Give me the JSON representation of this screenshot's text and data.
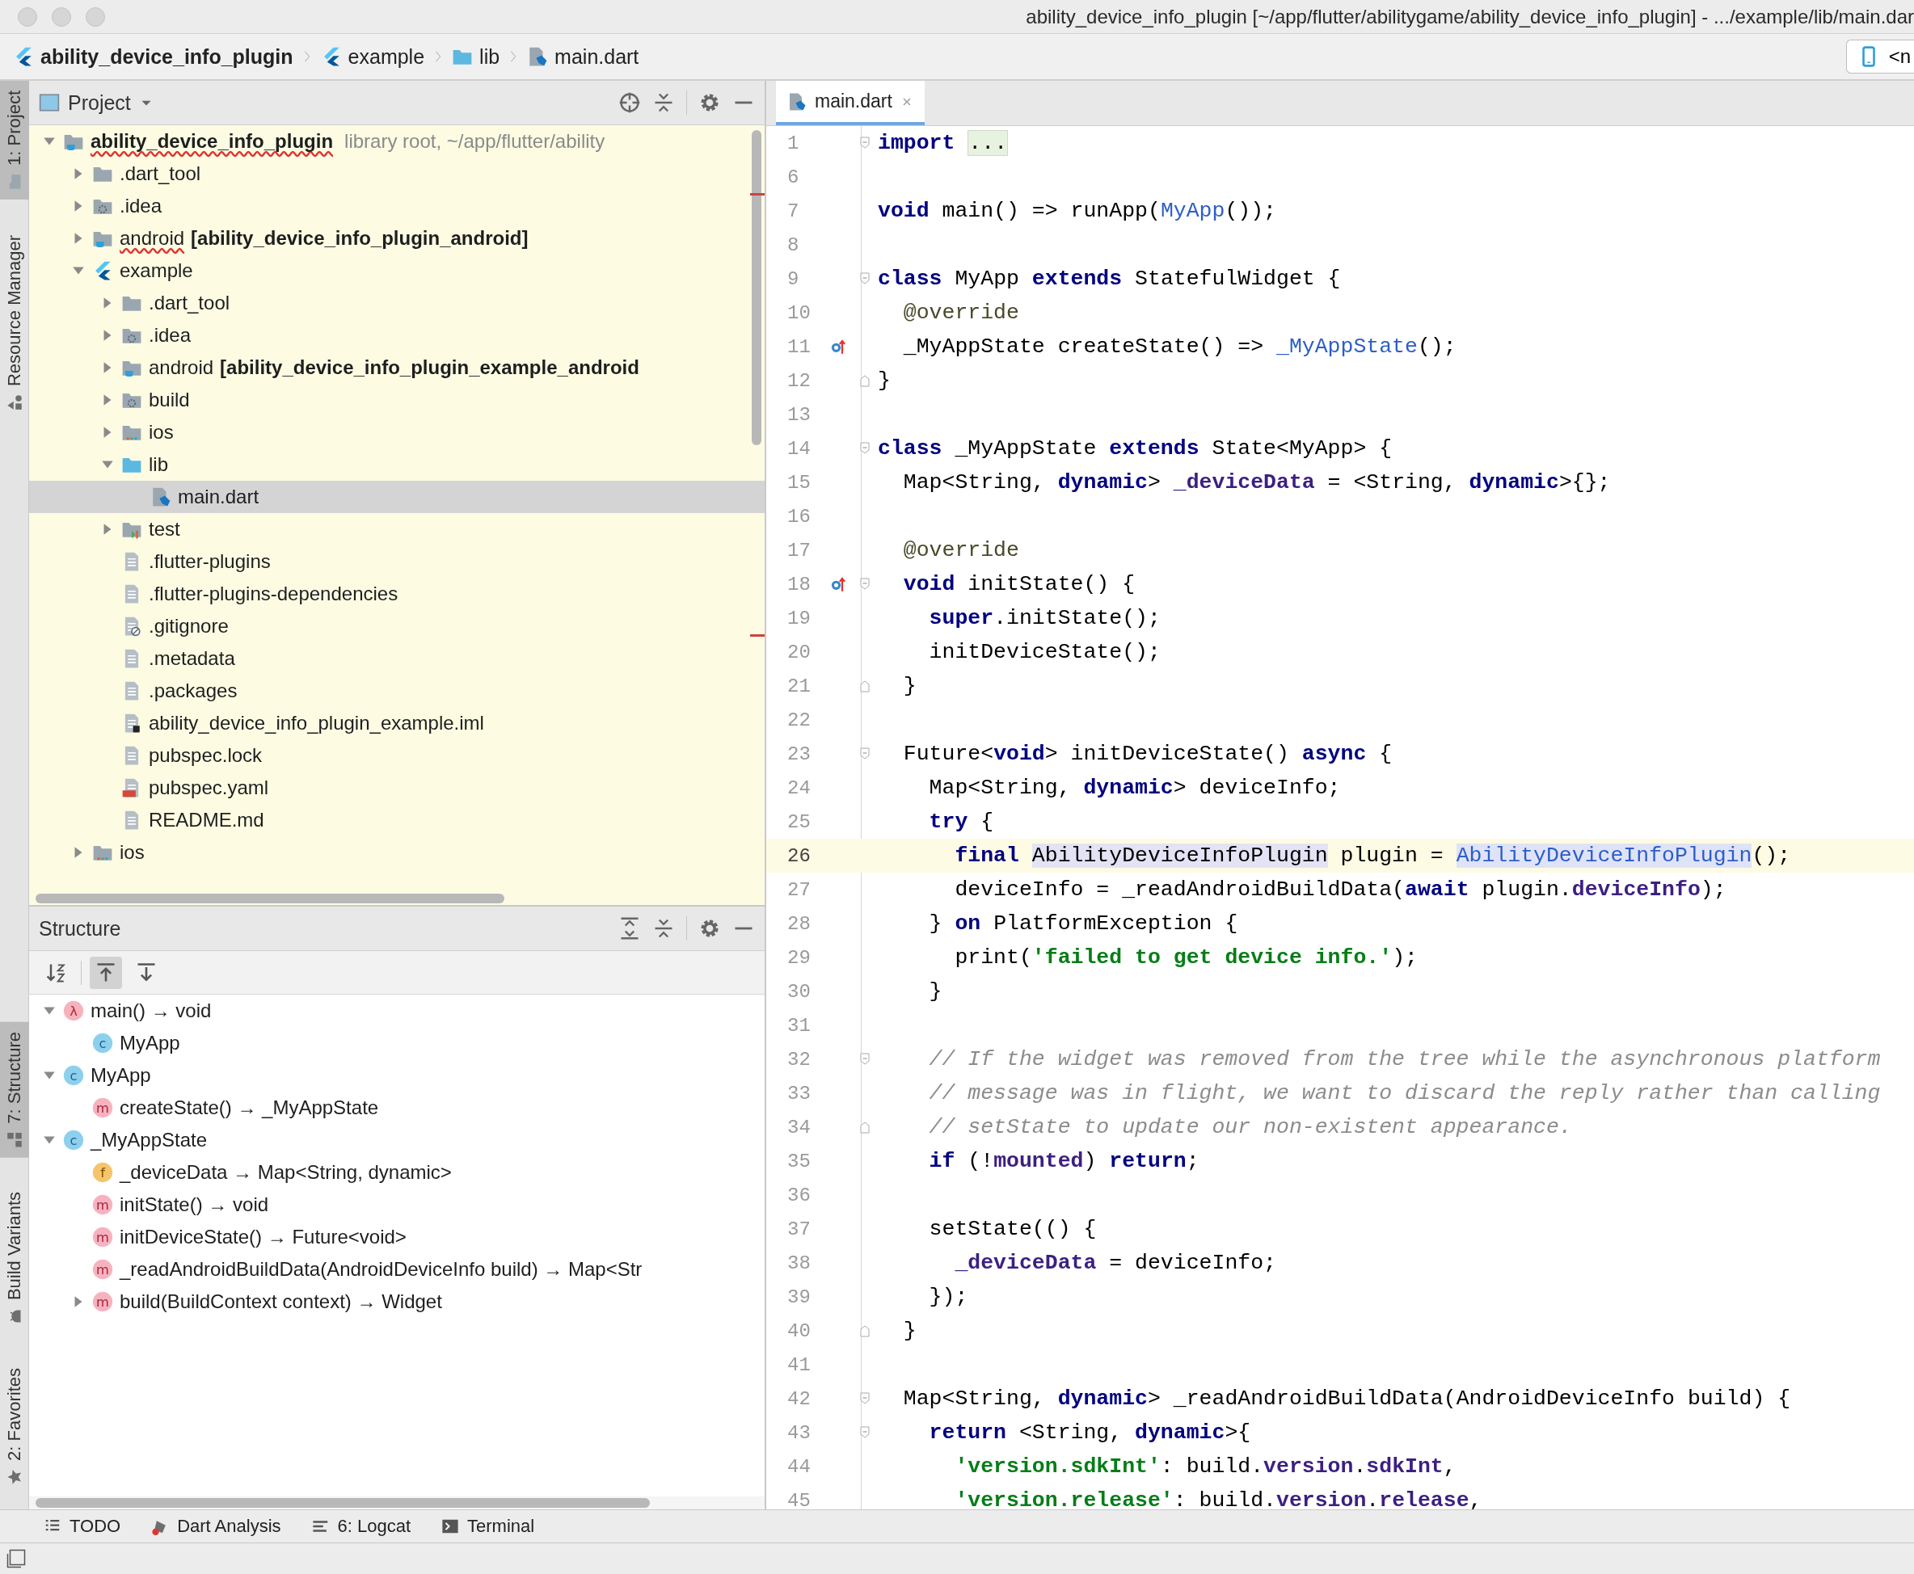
{
  "window": {
    "title": "ability_device_info_plugin [~/app/flutter/abilitygame/ability_device_info_plugin] - .../example/lib/main.dar"
  },
  "breadcrumbs": [
    {
      "label": "ability_device_info_plugin",
      "kind": "flutter"
    },
    {
      "label": "example",
      "kind": "flutter"
    },
    {
      "label": "lib",
      "kind": "folder-source"
    },
    {
      "label": "main.dart",
      "kind": "dart"
    }
  ],
  "device_selector": {
    "text": "<n"
  },
  "tool_stripe": {
    "top": [
      {
        "label": "1: Project",
        "selected": true,
        "kind": "folder"
      },
      {
        "label": "Resource Manager",
        "selected": false,
        "kind": "resources"
      }
    ],
    "bottom": [
      {
        "label": "7: Structure",
        "selected": true,
        "kind": "structure"
      },
      {
        "label": "Build Variants",
        "selected": false,
        "kind": "android"
      },
      {
        "label": "2: Favorites",
        "selected": false,
        "kind": "star"
      }
    ]
  },
  "project": {
    "title": "Project",
    "tree": [
      {
        "label": "ability_device_info_plugin",
        "hint": "library root,  ~/app/flutter/ability",
        "kind": "module",
        "misspelled": true,
        "expanded": true,
        "selected": false,
        "children": [
          {
            "label": ".dart_tool",
            "kind": "folder",
            "misspelled": false,
            "expanded": false,
            "selected": false
          },
          {
            "label": ".idea",
            "kind": "folder-config",
            "misspelled": false,
            "expanded": false,
            "selected": false
          },
          {
            "label": "android",
            "module": "[ability_device_info_plugin_android]",
            "kind": "module",
            "misspelled": true,
            "expanded": false,
            "selected": false
          },
          {
            "label": "example",
            "kind": "flutter",
            "misspelled": false,
            "expanded": true,
            "selected": false,
            "children": [
              {
                "label": ".dart_tool",
                "kind": "folder",
                "misspelled": false,
                "expanded": false,
                "selected": false
              },
              {
                "label": ".idea",
                "kind": "folder-config",
                "misspelled": false,
                "expanded": false,
                "selected": false
              },
              {
                "label": "android",
                "module": "[ability_device_info_plugin_example_android",
                "kind": "module",
                "misspelled": false,
                "expanded": false,
                "selected": false
              },
              {
                "label": "build",
                "kind": "folder-config",
                "misspelled": false,
                "expanded": false,
                "selected": false
              },
              {
                "label": "ios",
                "kind": "folder-ios",
                "misspelled": false,
                "expanded": false,
                "selected": false
              },
              {
                "label": "lib",
                "kind": "folder-source",
                "misspelled": false,
                "expanded": true,
                "selected": false,
                "children": [
                  {
                    "label": "main.dart",
                    "kind": "dart",
                    "misspelled": false,
                    "selected": true
                  }
                ]
              },
              {
                "label": "test",
                "kind": "folder-test",
                "misspelled": false,
                "expanded": false,
                "selected": false
              },
              {
                "label": ".flutter-plugins",
                "kind": "text",
                "misspelled": false,
                "selected": false
              },
              {
                "label": ".flutter-plugins-dependencies",
                "kind": "text",
                "misspelled": false,
                "selected": false
              },
              {
                "label": ".gitignore",
                "kind": "ignore",
                "misspelled": false,
                "selected": false
              },
              {
                "label": ".metadata",
                "kind": "text",
                "misspelled": false,
                "selected": false
              },
              {
                "label": ".packages",
                "kind": "text",
                "misspelled": false,
                "selected": false
              },
              {
                "label": "ability_device_info_plugin_example.iml",
                "kind": "iml",
                "misspelled": false,
                "selected": false
              },
              {
                "label": "pubspec.lock",
                "kind": "text",
                "misspelled": false,
                "selected": false
              },
              {
                "label": "pubspec.yaml",
                "kind": "yaml",
                "misspelled": false,
                "selected": false
              },
              {
                "label": "README.md",
                "kind": "text",
                "misspelled": false,
                "selected": false
              }
            ]
          },
          {
            "label": "ios",
            "kind": "folder-ios",
            "misspelled": false,
            "expanded": false,
            "selected": false
          }
        ]
      }
    ]
  },
  "structure": {
    "title": "Structure",
    "tree": [
      {
        "label": "main() → void",
        "kind": "lambda",
        "letter": "λ",
        "expanded": true,
        "children": [
          {
            "label": "MyApp",
            "kind": "class",
            "letter": "c"
          }
        ]
      },
      {
        "label": "MyApp",
        "kind": "class",
        "letter": "c",
        "expanded": true,
        "children": [
          {
            "label": "createState() → _MyAppState",
            "kind": "method",
            "letter": "m"
          }
        ]
      },
      {
        "label": "_MyAppState",
        "kind": "class",
        "letter": "c",
        "expanded": true,
        "children": [
          {
            "label": "_deviceData → Map<String, dynamic>",
            "kind": "field",
            "letter": "f"
          },
          {
            "label": "initState() → void",
            "kind": "method",
            "letter": "m"
          },
          {
            "label": "initDeviceState() → Future<void>",
            "kind": "method",
            "letter": "m"
          },
          {
            "label": "_readAndroidBuildData(AndroidDeviceInfo build) → Map<Str",
            "kind": "method",
            "letter": "m"
          },
          {
            "label": "build(BuildContext context) → Widget",
            "kind": "method",
            "letter": "m",
            "expanded": false
          }
        ]
      }
    ]
  },
  "editor": {
    "tabs": [
      {
        "label": "main.dart",
        "selected": true
      }
    ],
    "lines": [
      {
        "number": "1",
        "kind": "fold-start",
        "current": false,
        "override": false,
        "tokens": [
          {
            "kind": "keyword",
            "text": "import "
          },
          {
            "kind": "folded",
            "text": "..."
          }
        ]
      },
      {
        "number": "6",
        "kind": "plain",
        "current": false,
        "override": false
      },
      {
        "number": "7",
        "kind": "plain",
        "current": false,
        "override": false,
        "tokens": [
          {
            "kind": "keyword",
            "text": "void"
          },
          {
            "kind": "plain",
            "text": " main() => runApp("
          },
          {
            "kind": "reference",
            "text": "MyApp"
          },
          {
            "kind": "plain",
            "text": "());"
          }
        ]
      },
      {
        "number": "8",
        "kind": "plain",
        "current": false,
        "override": false
      },
      {
        "number": "9",
        "kind": "fold-start",
        "current": false,
        "override": false,
        "tokens": [
          {
            "kind": "keyword",
            "text": "class"
          },
          {
            "kind": "plain",
            "text": " MyApp "
          },
          {
            "kind": "keyword",
            "text": "extends"
          },
          {
            "kind": "plain",
            "text": " StatefulWidget {"
          }
        ]
      },
      {
        "number": "10",
        "kind": "plain",
        "current": false,
        "override": false,
        "tokens": [
          {
            "kind": "annotation",
            "text": "  @override"
          }
        ]
      },
      {
        "number": "11",
        "kind": "plain",
        "current": false,
        "override": true,
        "tokens": [
          {
            "kind": "plain",
            "text": "  _MyAppState createState() => "
          },
          {
            "kind": "reference",
            "text": "_MyAppState"
          },
          {
            "kind": "plain",
            "text": "();"
          }
        ]
      },
      {
        "number": "12",
        "kind": "fold-end",
        "current": false,
        "override": false,
        "tokens": [
          {
            "kind": "plain",
            "text": "}"
          }
        ]
      },
      {
        "number": "13",
        "kind": "plain",
        "current": false,
        "override": false
      },
      {
        "number": "14",
        "kind": "fold-start",
        "current": false,
        "override": false,
        "tokens": [
          {
            "kind": "keyword",
            "text": "class"
          },
          {
            "kind": "plain",
            "text": " _MyAppState "
          },
          {
            "kind": "keyword",
            "text": "extends"
          },
          {
            "kind": "plain",
            "text": " State<MyApp> {"
          }
        ]
      },
      {
        "number": "15",
        "kind": "plain",
        "current": false,
        "override": false,
        "tokens": [
          {
            "kind": "plain",
            "text": "  Map<String, "
          },
          {
            "kind": "keyword",
            "text": "dynamic"
          },
          {
            "kind": "plain",
            "text": "> "
          },
          {
            "kind": "field",
            "text": "_deviceData"
          },
          {
            "kind": "plain",
            "text": " = <String, "
          },
          {
            "kind": "keyword",
            "text": "dynamic"
          },
          {
            "kind": "plain",
            "text": ">{};"
          }
        ]
      },
      {
        "number": "16",
        "kind": "plain",
        "current": false,
        "override": false
      },
      {
        "number": "17",
        "kind": "plain",
        "current": false,
        "override": false,
        "tokens": [
          {
            "kind": "annotation",
            "text": "  @override"
          }
        ]
      },
      {
        "number": "18",
        "kind": "fold-start",
        "current": false,
        "override": true,
        "tokens": [
          {
            "kind": "keyword",
            "text": "  void"
          },
          {
            "kind": "plain",
            "text": " initState() {"
          }
        ]
      },
      {
        "number": "19",
        "kind": "plain",
        "current": false,
        "override": false,
        "tokens": [
          {
            "kind": "keyword",
            "text": "    super"
          },
          {
            "kind": "plain",
            "text": ".initState();"
          }
        ]
      },
      {
        "number": "20",
        "kind": "plain",
        "current": false,
        "override": false,
        "tokens": [
          {
            "kind": "plain",
            "text": "    initDeviceState();"
          }
        ]
      },
      {
        "number": "21",
        "kind": "fold-end",
        "current": false,
        "override": false,
        "tokens": [
          {
            "kind": "plain",
            "text": "  }"
          }
        ]
      },
      {
        "number": "22",
        "kind": "plain",
        "current": false,
        "override": false
      },
      {
        "number": "23",
        "kind": "fold-start",
        "current": false,
        "override": false,
        "tokens": [
          {
            "kind": "plain",
            "text": "  Future<"
          },
          {
            "kind": "keyword",
            "text": "void"
          },
          {
            "kind": "plain",
            "text": "> initDeviceState() "
          },
          {
            "kind": "keyword",
            "text": "async"
          },
          {
            "kind": "plain",
            "text": " {"
          }
        ]
      },
      {
        "number": "24",
        "kind": "plain",
        "current": false,
        "override": false,
        "tokens": [
          {
            "kind": "plain",
            "text": "    Map<String, "
          },
          {
            "kind": "keyword",
            "text": "dynamic"
          },
          {
            "kind": "plain",
            "text": "> deviceInfo;"
          }
        ]
      },
      {
        "number": "25",
        "kind": "plain",
        "current": false,
        "override": false,
        "tokens": [
          {
            "kind": "keyword",
            "text": "    try"
          },
          {
            "kind": "plain",
            "text": " {"
          }
        ]
      },
      {
        "number": "26",
        "kind": "plain",
        "current": true,
        "override": false,
        "tokens": [
          {
            "kind": "keyword",
            "text": "      final "
          },
          {
            "kind": "usage",
            "text": "AbilityDeviceInfoPlugin"
          },
          {
            "kind": "plain",
            "text": " plugin = "
          },
          {
            "kind": "reference-usage",
            "text": "AbilityDeviceInfoPlugin"
          },
          {
            "kind": "plain",
            "text": "();"
          }
        ]
      },
      {
        "number": "27",
        "kind": "plain",
        "current": false,
        "override": false,
        "tokens": [
          {
            "kind": "plain",
            "text": "      deviceInfo = _readAndroidBuildData("
          },
          {
            "kind": "keyword",
            "text": "await"
          },
          {
            "kind": "plain",
            "text": " plugin."
          },
          {
            "kind": "field",
            "text": "deviceInfo"
          },
          {
            "kind": "plain",
            "text": ");"
          }
        ]
      },
      {
        "number": "28",
        "kind": "plain",
        "current": false,
        "override": false,
        "tokens": [
          {
            "kind": "plain",
            "text": "    } "
          },
          {
            "kind": "keyword",
            "text": "on"
          },
          {
            "kind": "plain",
            "text": " PlatformException {"
          }
        ]
      },
      {
        "number": "29",
        "kind": "plain",
        "current": false,
        "override": false,
        "tokens": [
          {
            "kind": "plain",
            "text": "      print("
          },
          {
            "kind": "string",
            "text": "'failed to get device info.'"
          },
          {
            "kind": "plain",
            "text": ");"
          }
        ]
      },
      {
        "number": "30",
        "kind": "plain",
        "current": false,
        "override": false,
        "tokens": [
          {
            "kind": "plain",
            "text": "    }"
          }
        ]
      },
      {
        "number": "31",
        "kind": "plain",
        "current": false,
        "override": false
      },
      {
        "number": "32",
        "kind": "fold-start",
        "current": false,
        "override": false,
        "tokens": [
          {
            "kind": "comment",
            "text": "    // If the widget was removed from the tree while the asynchronous platform"
          }
        ]
      },
      {
        "number": "33",
        "kind": "plain",
        "current": false,
        "override": false,
        "tokens": [
          {
            "kind": "comment",
            "text": "    // message was in flight, we want to discard the reply rather than calling"
          }
        ]
      },
      {
        "number": "34",
        "kind": "fold-end",
        "current": false,
        "override": false,
        "tokens": [
          {
            "kind": "comment",
            "text": "    // setState to update our non-existent appearance."
          }
        ]
      },
      {
        "number": "35",
        "kind": "plain",
        "current": false,
        "override": false,
        "tokens": [
          {
            "kind": "keyword",
            "text": "    if"
          },
          {
            "kind": "plain",
            "text": " (!"
          },
          {
            "kind": "field",
            "text": "mounted"
          },
          {
            "kind": "plain",
            "text": ") "
          },
          {
            "kind": "keyword",
            "text": "return"
          },
          {
            "kind": "plain",
            "text": ";"
          }
        ]
      },
      {
        "number": "36",
        "kind": "plain",
        "current": false,
        "override": false
      },
      {
        "number": "37",
        "kind": "plain",
        "current": false,
        "override": false,
        "tokens": [
          {
            "kind": "plain",
            "text": "    setState(() {"
          }
        ]
      },
      {
        "number": "38",
        "kind": "plain",
        "current": false,
        "override": false,
        "tokens": [
          {
            "kind": "field",
            "text": "      _deviceData"
          },
          {
            "kind": "plain",
            "text": " = deviceInfo;"
          }
        ]
      },
      {
        "number": "39",
        "kind": "plain",
        "current": false,
        "override": false,
        "tokens": [
          {
            "kind": "plain",
            "text": "    });"
          }
        ]
      },
      {
        "number": "40",
        "kind": "fold-end",
        "current": false,
        "override": false,
        "tokens": [
          {
            "kind": "plain",
            "text": "  }"
          }
        ]
      },
      {
        "number": "41",
        "kind": "plain",
        "current": false,
        "override": false
      },
      {
        "number": "42",
        "kind": "fold-start",
        "current": false,
        "override": false,
        "tokens": [
          {
            "kind": "plain",
            "text": "  Map<String, "
          },
          {
            "kind": "keyword",
            "text": "dynamic"
          },
          {
            "kind": "plain",
            "text": "> _readAndroidBuildData(AndroidDeviceInfo build) {"
          }
        ]
      },
      {
        "number": "43",
        "kind": "fold-start",
        "current": false,
        "override": false,
        "tokens": [
          {
            "kind": "keyword",
            "text": "    return"
          },
          {
            "kind": "plain",
            "text": " <String, "
          },
          {
            "kind": "keyword",
            "text": "dynamic"
          },
          {
            "kind": "plain",
            "text": ">{"
          }
        ]
      },
      {
        "number": "44",
        "kind": "plain",
        "current": false,
        "override": false,
        "tokens": [
          {
            "kind": "string",
            "text": "      'version.sdkInt'"
          },
          {
            "kind": "plain",
            "text": ": build."
          },
          {
            "kind": "field",
            "text": "version"
          },
          {
            "kind": "plain",
            "text": "."
          },
          {
            "kind": "field",
            "text": "sdkInt"
          },
          {
            "kind": "plain",
            "text": ","
          }
        ]
      },
      {
        "number": "45",
        "kind": "plain",
        "current": false,
        "override": false,
        "tokens": [
          {
            "kind": "string",
            "text": "      'version.release'"
          },
          {
            "kind": "plain",
            "text": ": build."
          },
          {
            "kind": "field",
            "text": "version"
          },
          {
            "kind": "plain",
            "text": "."
          },
          {
            "kind": "field",
            "text": "release"
          },
          {
            "kind": "plain",
            "text": ","
          }
        ]
      }
    ]
  },
  "tool_windows": [
    {
      "label": "TODO",
      "kind": "list"
    },
    {
      "label": "Dart Analysis",
      "kind": "dart-analysis"
    },
    {
      "label": "6: Logcat",
      "kind": "logcat"
    },
    {
      "label": "Terminal",
      "kind": "terminal"
    }
  ]
}
